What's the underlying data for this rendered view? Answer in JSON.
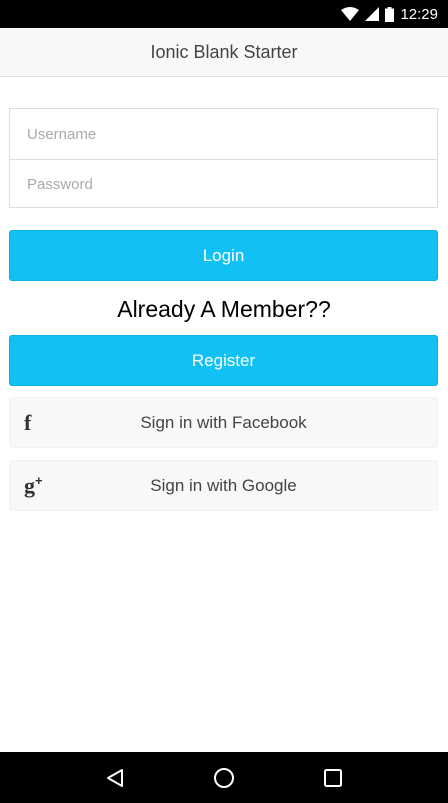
{
  "status_bar": {
    "time": "12:29",
    "icons": [
      "wifi-icon",
      "signal-icon",
      "battery-icon"
    ]
  },
  "header": {
    "title": "Ionic Blank Starter"
  },
  "form": {
    "username_placeholder": "Username",
    "password_placeholder": "Password"
  },
  "buttons": {
    "login_label": "Login",
    "member_text": "Already A Member??",
    "register_label": "Register",
    "facebook_label": "Sign in with Facebook",
    "google_label": "Sign in with Google"
  },
  "social_icons": {
    "facebook": "f",
    "google": "g",
    "google_plus": "+"
  },
  "nav_bar": {
    "icons": [
      "back-icon",
      "home-icon",
      "recents-icon"
    ]
  },
  "colors": {
    "primary": "#11c1f3",
    "header_bg": "#f8f8f8",
    "social_bg": "#f8f8f8"
  }
}
